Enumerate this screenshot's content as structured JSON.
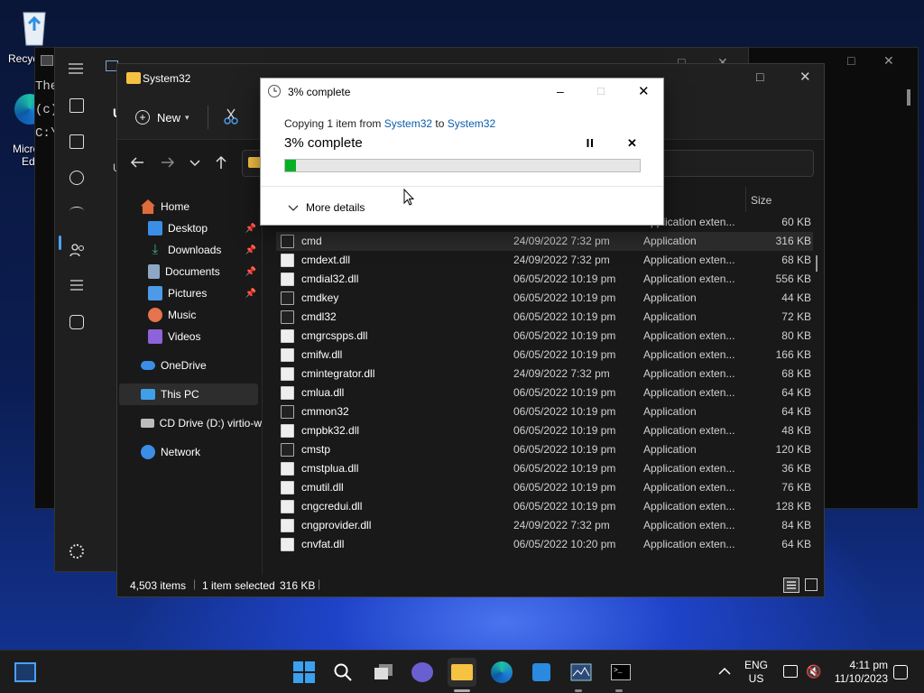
{
  "desktop": {
    "recycle_label": "Recyc",
    "edge_label_1": "Micro",
    "edge_label_2": "Ed"
  },
  "terminal_back": {
    "line1": "The",
    "line2": "(c)",
    "line3": "C:\\"
  },
  "task_manager": {
    "sidebar_partial": "U",
    "sidebar_partial2": "U"
  },
  "explorer": {
    "title": "System32",
    "new_label": "New",
    "nav_items": [
      {
        "label": "Home"
      },
      {
        "label": "Desktop"
      },
      {
        "label": "Downloads"
      },
      {
        "label": "Documents"
      },
      {
        "label": "Pictures"
      },
      {
        "label": "Music"
      },
      {
        "label": "Videos"
      },
      {
        "label": "OneDrive"
      },
      {
        "label": "This PC"
      },
      {
        "label": "CD Drive (D:) virtio-w"
      },
      {
        "label": "Network"
      }
    ],
    "size_header": "Size",
    "partial_row": {
      "type": "Application exten...",
      "size": "60 KB"
    },
    "files": [
      {
        "name": "cmd",
        "date": "24/09/2022 7:32 pm",
        "type": "Application",
        "size": "316 KB"
      },
      {
        "name": "cmdext.dll",
        "date": "24/09/2022 7:32 pm",
        "type": "Application exten...",
        "size": "68 KB"
      },
      {
        "name": "cmdial32.dll",
        "date": "06/05/2022 10:19 pm",
        "type": "Application exten...",
        "size": "556 KB"
      },
      {
        "name": "cmdkey",
        "date": "06/05/2022 10:19 pm",
        "type": "Application",
        "size": "44 KB"
      },
      {
        "name": "cmdl32",
        "date": "06/05/2022 10:19 pm",
        "type": "Application",
        "size": "72 KB"
      },
      {
        "name": "cmgrcspps.dll",
        "date": "06/05/2022 10:19 pm",
        "type": "Application exten...",
        "size": "80 KB"
      },
      {
        "name": "cmifw.dll",
        "date": "06/05/2022 10:19 pm",
        "type": "Application exten...",
        "size": "166 KB"
      },
      {
        "name": "cmintegrator.dll",
        "date": "24/09/2022 7:32 pm",
        "type": "Application exten...",
        "size": "68 KB"
      },
      {
        "name": "cmlua.dll",
        "date": "06/05/2022 10:19 pm",
        "type": "Application exten...",
        "size": "64 KB"
      },
      {
        "name": "cmmon32",
        "date": "06/05/2022 10:19 pm",
        "type": "Application",
        "size": "64 KB"
      },
      {
        "name": "cmpbk32.dll",
        "date": "06/05/2022 10:19 pm",
        "type": "Application exten...",
        "size": "48 KB"
      },
      {
        "name": "cmstp",
        "date": "06/05/2022 10:19 pm",
        "type": "Application",
        "size": "120 KB"
      },
      {
        "name": "cmstplua.dll",
        "date": "06/05/2022 10:19 pm",
        "type": "Application exten...",
        "size": "36 KB"
      },
      {
        "name": "cmutil.dll",
        "date": "06/05/2022 10:19 pm",
        "type": "Application exten...",
        "size": "76 KB"
      },
      {
        "name": "cngcredui.dll",
        "date": "06/05/2022 10:19 pm",
        "type": "Application exten...",
        "size": "128 KB"
      },
      {
        "name": "cngprovider.dll",
        "date": "24/09/2022 7:32 pm",
        "type": "Application exten...",
        "size": "84 KB"
      },
      {
        "name": "cnvfat.dll",
        "date": "06/05/2022 10:20 pm",
        "type": "Application exten...",
        "size": "64 KB"
      }
    ],
    "status": {
      "items": "4,503 items",
      "selected": "1 item selected",
      "size": "316 KB"
    }
  },
  "dialog": {
    "title": "3% complete",
    "copy_prefix": "Copying 1 item from",
    "source": "System32",
    "to_word": "to",
    "dest": "System32",
    "progress_text": "3% complete",
    "progress_fraction": 0.03,
    "more_details": "More details"
  },
  "taskbar": {
    "lang1": "ENG",
    "lang2": "US",
    "time": "4:11 pm",
    "date": "11/10/2023"
  },
  "colors": {
    "accent": "#0b5cad",
    "progress": "#06b025"
  }
}
